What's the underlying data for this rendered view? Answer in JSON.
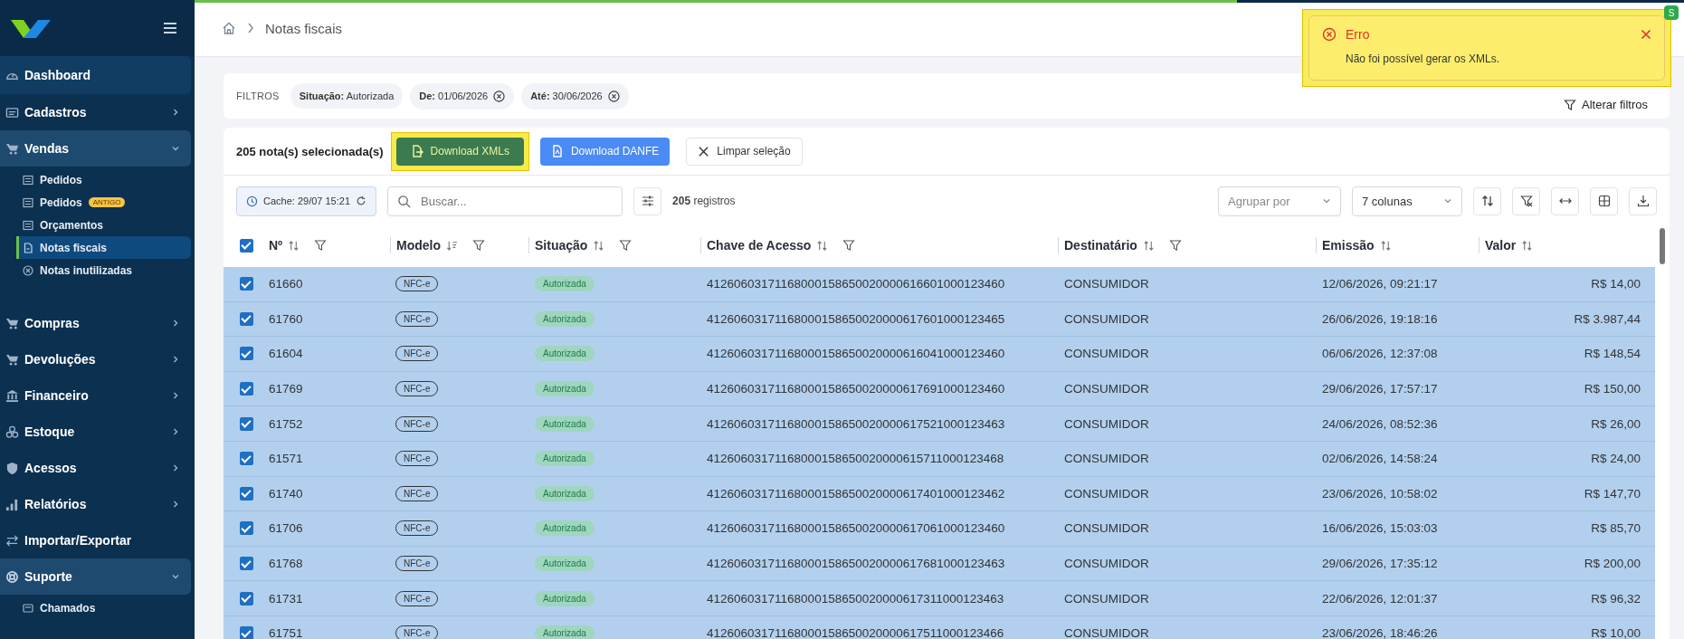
{
  "sidebar": {
    "items": [
      {
        "label": "Dashboard"
      },
      {
        "label": "Cadastros",
        "expanded": false
      },
      {
        "label": "Vendas",
        "expanded": true,
        "children": [
          {
            "label": "Pedidos",
            "selected": false
          },
          {
            "label": "Pedidos",
            "badge": "ANTIGO",
            "selected": false
          },
          {
            "label": "Orçamentos",
            "selected": false
          },
          {
            "label": "Notas fiscais",
            "selected": true
          },
          {
            "label": "Notas inutilizadas",
            "selected": false
          }
        ]
      },
      {
        "label": "Compras",
        "expanded": false
      },
      {
        "label": "Devoluções",
        "expanded": false
      },
      {
        "label": "Financeiro",
        "expanded": false
      },
      {
        "label": "Estoque",
        "expanded": false
      },
      {
        "label": "Acessos",
        "expanded": false
      },
      {
        "label": "Relatórios",
        "expanded": false
      },
      {
        "label": "Importar/Exportar"
      },
      {
        "label": "Suporte",
        "expanded": true,
        "children": [
          {
            "label": "Chamados",
            "selected": false
          }
        ]
      }
    ]
  },
  "loading_bar": {
    "level": 0.7
  },
  "breadcrumb": [
    "Notas fiscais"
  ],
  "avatar_badge": "S",
  "filters": {
    "label": "FILTROS",
    "chips": [
      {
        "text": "**Situação:** Autorizada",
        "removable": false
      },
      {
        "text": "**De:** 01/06/2026",
        "removable": true
      },
      {
        "text": "**Até:** 30/06/2026",
        "removable": true
      }
    ],
    "action": "Alterar filtros"
  },
  "selection": {
    "count": "205 nota(s) selecionada(s)",
    "buttons": [
      {
        "label": "Download XMLs",
        "kind": "green",
        "highlighted": true
      },
      {
        "label": "Download DANFE",
        "kind": "blue",
        "highlighted": false
      },
      {
        "label": "Limpar seleção",
        "kind": "clear",
        "highlighted": false
      }
    ]
  },
  "toolbar": {
    "cache": "Cache: 29/07 15:21",
    "search": {
      "placeholder": "Buscar..."
    },
    "records": "**205** registros",
    "group_by": {
      "placeholder": "Agrupar por"
    },
    "columns_select": {
      "value": "7 colunas"
    }
  },
  "table": {
    "all_selected": true,
    "columns": [
      {
        "label": "Nº",
        "sorted": false,
        "filter": true
      },
      {
        "label": "Modelo",
        "sorted": true,
        "filter": true
      },
      {
        "label": "Situação",
        "sorted": false,
        "filter": true
      },
      {
        "label": "Chave de Acesso",
        "sorted": false,
        "filter": true
      },
      {
        "label": "Destinatário",
        "sorted": false,
        "filter": true
      },
      {
        "label": "Emissão",
        "sorted": false,
        "filter": false
      },
      {
        "label": "Valor",
        "sorted": false,
        "filter": false
      }
    ],
    "rows": [
      {
        "selected": true,
        "cells": [
          "61660",
          "NFC-e",
          "Autorizada",
          "41260603171168000158650020000616601000123460",
          "CONSUMIDOR",
          "12/06/2026, 09:21:17",
          "R$ 14,00"
        ]
      },
      {
        "selected": true,
        "cells": [
          "61760",
          "NFC-e",
          "Autorizada",
          "41260603171168000158650020000617601000123465",
          "CONSUMIDOR",
          "26/06/2026, 19:18:16",
          "R$ 3.987,44"
        ]
      },
      {
        "selected": true,
        "cells": [
          "61604",
          "NFC-e",
          "Autorizada",
          "41260603171168000158650020000616041000123460",
          "CONSUMIDOR",
          "06/06/2026, 12:37:08",
          "R$ 148,54"
        ]
      },
      {
        "selected": true,
        "cells": [
          "61769",
          "NFC-e",
          "Autorizada",
          "41260603171168000158650020000617691000123460",
          "CONSUMIDOR",
          "29/06/2026, 17:57:17",
          "R$ 150,00"
        ]
      },
      {
        "selected": true,
        "cells": [
          "61752",
          "NFC-e",
          "Autorizada",
          "41260603171168000158650020000617521000123463",
          "CONSUMIDOR",
          "24/06/2026, 08:52:36",
          "R$ 26,00"
        ]
      },
      {
        "selected": true,
        "cells": [
          "61571",
          "NFC-e",
          "Autorizada",
          "41260603171168000158650020000615711000123468",
          "CONSUMIDOR",
          "02/06/2026, 14:58:24",
          "R$ 24,00"
        ]
      },
      {
        "selected": true,
        "cells": [
          "61740",
          "NFC-e",
          "Autorizada",
          "41260603171168000158650020000617401000123462",
          "CONSUMIDOR",
          "23/06/2026, 10:58:02",
          "R$ 147,70"
        ]
      },
      {
        "selected": true,
        "cells": [
          "61706",
          "NFC-e",
          "Autorizada",
          "41260603171168000158650020000617061000123460",
          "CONSUMIDOR",
          "16/06/2026, 15:03:03",
          "R$ 85,70"
        ]
      },
      {
        "selected": true,
        "cells": [
          "61768",
          "NFC-e",
          "Autorizada",
          "41260603171168000158650020000617681000123463",
          "CONSUMIDOR",
          "29/06/2026, 17:35:12",
          "R$ 200,00"
        ]
      },
      {
        "selected": true,
        "cells": [
          "61731",
          "NFC-e",
          "Autorizada",
          "41260603171168000158650020000617311000123463",
          "CONSUMIDOR",
          "22/06/2026, 12:01:37",
          "R$ 96,32"
        ]
      },
      {
        "selected": true,
        "cells": [
          "61751",
          "NFC-e",
          "Autorizada",
          "41260603171168000158650020000617511000123466",
          "CONSUMIDOR",
          "23/06/2026, 18:46:26",
          "R$ 10,00"
        ]
      }
    ]
  },
  "toast": {
    "title": "Erro",
    "message": "Não foi possível gerar os XMLs.",
    "highlighted": true
  }
}
